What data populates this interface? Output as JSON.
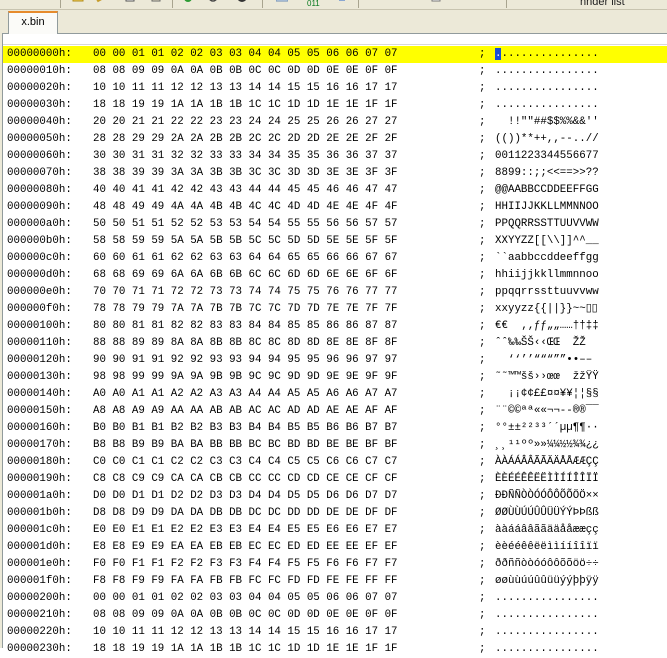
{
  "toolbar": {
    "label_011": "011",
    "label_right": "hnder list"
  },
  "tab": {
    "label": "x.bin"
  },
  "hex": {
    "rows": [
      {
        "addr": "00000000h:",
        "hex": "00 00 01 01 02 02 03 03 04 04 05 05 06 06 07 07",
        "sep": ";",
        "ascii": "................",
        "highlight": true
      },
      {
        "addr": "00000010h:",
        "hex": "08 08 09 09 0A 0A 0B 0B 0C 0C 0D 0D 0E 0E 0F 0F",
        "sep": ";",
        "ascii": "................"
      },
      {
        "addr": "00000020h:",
        "hex": "10 10 11 11 12 12 13 13 14 14 15 15 16 16 17 17",
        "sep": ";",
        "ascii": "................"
      },
      {
        "addr": "00000030h:",
        "hex": "18 18 19 19 1A 1A 1B 1B 1C 1C 1D 1D 1E 1E 1F 1F",
        "sep": ";",
        "ascii": "................"
      },
      {
        "addr": "00000040h:",
        "hex": "20 20 21 21 22 22 23 23 24 24 25 25 26 26 27 27",
        "sep": ";",
        "ascii": "  !!\"\"##$$%%&&''"
      },
      {
        "addr": "00000050h:",
        "hex": "28 28 29 29 2A 2A 2B 2B 2C 2C 2D 2D 2E 2E 2F 2F",
        "sep": ";",
        "ascii": "(())**++,,--..//"
      },
      {
        "addr": "00000060h:",
        "hex": "30 30 31 31 32 32 33 33 34 34 35 35 36 36 37 37",
        "sep": ";",
        "ascii": "0011223344556677"
      },
      {
        "addr": "00000070h:",
        "hex": "38 38 39 39 3A 3A 3B 3B 3C 3C 3D 3D 3E 3E 3F 3F",
        "sep": ";",
        "ascii": "8899::;;<<==>>??"
      },
      {
        "addr": "00000080h:",
        "hex": "40 40 41 41 42 42 43 43 44 44 45 45 46 46 47 47",
        "sep": ";",
        "ascii": "@@AABBCCDDEEFFGG"
      },
      {
        "addr": "00000090h:",
        "hex": "48 48 49 49 4A 4A 4B 4B 4C 4C 4D 4D 4E 4E 4F 4F",
        "sep": ";",
        "ascii": "HHIIJJKKLLMMNNOO"
      },
      {
        "addr": "000000a0h:",
        "hex": "50 50 51 51 52 52 53 53 54 54 55 55 56 56 57 57",
        "sep": ";",
        "ascii": "PPQQRRSSTTUUVVWW"
      },
      {
        "addr": "000000b0h:",
        "hex": "58 58 59 59 5A 5A 5B 5B 5C 5C 5D 5D 5E 5E 5F 5F",
        "sep": ";",
        "ascii": "XXYYZZ[[\\\\]]^^__"
      },
      {
        "addr": "000000c0h:",
        "hex": "60 60 61 61 62 62 63 63 64 64 65 65 66 66 67 67",
        "sep": ";",
        "ascii": "``aabbccddeeffgg"
      },
      {
        "addr": "000000d0h:",
        "hex": "68 68 69 69 6A 6A 6B 6B 6C 6C 6D 6D 6E 6E 6F 6F",
        "sep": ";",
        "ascii": "hhiijjkkllmmnnoo"
      },
      {
        "addr": "000000e0h:",
        "hex": "70 70 71 71 72 72 73 73 74 74 75 75 76 76 77 77",
        "sep": ";",
        "ascii": "ppqqrrssttuuvvww"
      },
      {
        "addr": "000000f0h:",
        "hex": "78 78 79 79 7A 7A 7B 7B 7C 7C 7D 7D 7E 7E 7F 7F",
        "sep": ";",
        "ascii": "xxyyzz{{||}}~~▯▯"
      },
      {
        "addr": "00000100h:",
        "hex": "80 80 81 81 82 82 83 83 84 84 85 85 86 86 87 87",
        "sep": ";",
        "ascii": "€€  ‚‚ƒƒ„„……††‡‡"
      },
      {
        "addr": "00000110h:",
        "hex": "88 88 89 89 8A 8A 8B 8B 8C 8C 8D 8D 8E 8E 8F 8F",
        "sep": ";",
        "ascii": "ˆˆ‰‰ŠŠ‹‹ŒŒ  ŽŽ  "
      },
      {
        "addr": "00000120h:",
        "hex": "90 90 91 91 92 92 93 93 94 94 95 95 96 96 97 97",
        "sep": ";",
        "ascii": "  ‘‘’’“““””••––"
      },
      {
        "addr": "00000130h:",
        "hex": "98 98 99 99 9A 9A 9B 9B 9C 9C 9D 9D 9E 9E 9F 9F",
        "sep": ";",
        "ascii": "˜˜™™šš››œœ  žžŸŸ"
      },
      {
        "addr": "00000140h:",
        "hex": "A0 A0 A1 A1 A2 A2 A3 A3 A4 A4 A5 A5 A6 A6 A7 A7",
        "sep": ";",
        "ascii": "  ¡¡¢¢££¤¤¥¥¦¦§§"
      },
      {
        "addr": "00000150h:",
        "hex": "A8 A8 A9 A9 AA AA AB AB AC AC AD AD AE AE AF AF",
        "sep": ";",
        "ascii": "¨¨©©ªª««¬¬--®®¯¯"
      },
      {
        "addr": "00000160h:",
        "hex": "B0 B0 B1 B1 B2 B2 B3 B3 B4 B4 B5 B5 B6 B6 B7 B7",
        "sep": ";",
        "ascii": "°°±±²²³³´´µµ¶¶··"
      },
      {
        "addr": "00000170h:",
        "hex": "B8 B8 B9 B9 BA BA BB BB BC BC BD BD BE BE BF BF",
        "sep": ";",
        "ascii": "¸¸¹¹ºº»»¼¼½½¾¾¿¿"
      },
      {
        "addr": "00000180h:",
        "hex": "C0 C0 C1 C1 C2 C2 C3 C3 C4 C4 C5 C5 C6 C6 C7 C7",
        "sep": ";",
        "ascii": "ÀÀÁÁÂÂÃÃÄÄÅÅÆÆÇÇ"
      },
      {
        "addr": "00000190h:",
        "hex": "C8 C8 C9 C9 CA CA CB CB CC CC CD CD CE CE CF CF",
        "sep": ";",
        "ascii": "ÈÈÉÉÊÊËËÌÌÍÍÎÎÏÏ"
      },
      {
        "addr": "000001a0h:",
        "hex": "D0 D0 D1 D1 D2 D2 D3 D3 D4 D4 D5 D5 D6 D6 D7 D7",
        "sep": ";",
        "ascii": "ÐÐÑÑÒÒÓÓÔÔÕÕÖÖ××"
      },
      {
        "addr": "000001b0h:",
        "hex": "D8 D8 D9 D9 DA DA DB DB DC DC DD DD DE DE DF DF",
        "sep": ";",
        "ascii": "ØØÙÙÚÚÛÛÜÜÝÝÞÞßß"
      },
      {
        "addr": "000001c0h:",
        "hex": "E0 E0 E1 E1 E2 E2 E3 E3 E4 E4 E5 E5 E6 E6 E7 E7",
        "sep": ";",
        "ascii": "ààááââããääååææçç"
      },
      {
        "addr": "000001d0h:",
        "hex": "E8 E8 E9 E9 EA EA EB EB EC EC ED ED EE EE EF EF",
        "sep": ";",
        "ascii": "èèééêêëëììííîîïï"
      },
      {
        "addr": "000001e0h:",
        "hex": "F0 F0 F1 F1 F2 F2 F3 F3 F4 F4 F5 F5 F6 F6 F7 F7",
        "sep": ";",
        "ascii": "ððññòòóóôôõõöö÷÷"
      },
      {
        "addr": "000001f0h:",
        "hex": "F8 F8 F9 F9 FA FA FB FB FC FC FD FD FE FE FF FF",
        "sep": ";",
        "ascii": "øøùùúúûûüüýýþþÿÿ"
      },
      {
        "addr": "00000200h:",
        "hex": "00 00 01 01 02 02 03 03 04 04 05 05 06 06 07 07",
        "sep": ";",
        "ascii": "................"
      },
      {
        "addr": "00000210h:",
        "hex": "08 08 09 09 0A 0A 0B 0B 0C 0C 0D 0D 0E 0E 0F 0F",
        "sep": ";",
        "ascii": "................"
      },
      {
        "addr": "00000220h:",
        "hex": "10 10 11 11 12 12 13 13 14 14 15 15 16 16 17 17",
        "sep": ";",
        "ascii": "................"
      },
      {
        "addr": "00000230h:",
        "hex": "18 18 19 19 1A 1A 1B 1B 1C 1C 1D 1D 1E 1E 1F 1F",
        "sep": ";",
        "ascii": "................"
      }
    ]
  },
  "colors": {
    "highlight_row": "#ffff00",
    "cursor": "#1a4fd6",
    "tab_accent": "#e68b2c",
    "chrome": "#ece9d8"
  }
}
